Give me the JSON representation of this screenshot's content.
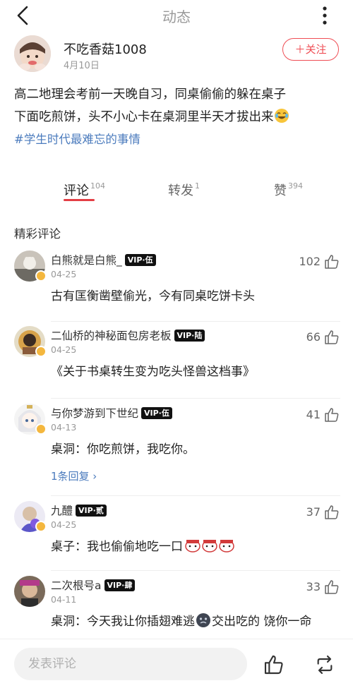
{
  "header": {
    "title": "动态"
  },
  "author": {
    "name": "不吃香菇1008",
    "date": "4月10日",
    "follow_label": "＋关注"
  },
  "post": {
    "text_line1": "高二地理会考前一天晚自习，同桌偷偷的躲在桌子",
    "text_line2": "下面吃煎饼，头不小心卡在桌洞里半天才拔出来",
    "hashtag": "#学生时代最难忘的事情"
  },
  "tabs": [
    {
      "label": "评论",
      "count": "104"
    },
    {
      "label": "转发",
      "count": "1"
    },
    {
      "label": "赞",
      "count": "394"
    }
  ],
  "section_title": "精彩评论",
  "comments": [
    {
      "name": "白熊就是白熊_",
      "vip": "VIP·伍",
      "date": "04-25",
      "likes": "102",
      "text": "古有匡衡凿壁偷光，今有同桌吃饼卡头"
    },
    {
      "name": "二仙桥的神秘面包房老板",
      "vip": "VIP·陆",
      "date": "04-25",
      "likes": "66",
      "text": "《关于书桌转生变为吃头怪兽这档事》"
    },
    {
      "name": "与你梦游到下世纪",
      "vip": "VIP·伍",
      "date": "04-13",
      "likes": "41",
      "text": "桌洞：你吃煎饼，我吃你。",
      "reply": "1条回复 ›"
    },
    {
      "name": "九醴",
      "vip": "VIP·贰",
      "date": "04-25",
      "likes": "37",
      "text": "桌子：我也偷偷地吃一口"
    },
    {
      "name": "二次根号a",
      "vip": "VIP·肆",
      "date": "04-11",
      "likes": "33",
      "text_a": "桌洞：今天我让你插翅难逃",
      "text_b": "交出吃的 饶你一命"
    }
  ],
  "footer": {
    "input_placeholder": "发表评论"
  },
  "colors": {
    "accent": "#ef4d54",
    "link": "#4b7bbd",
    "muted": "#999999"
  }
}
